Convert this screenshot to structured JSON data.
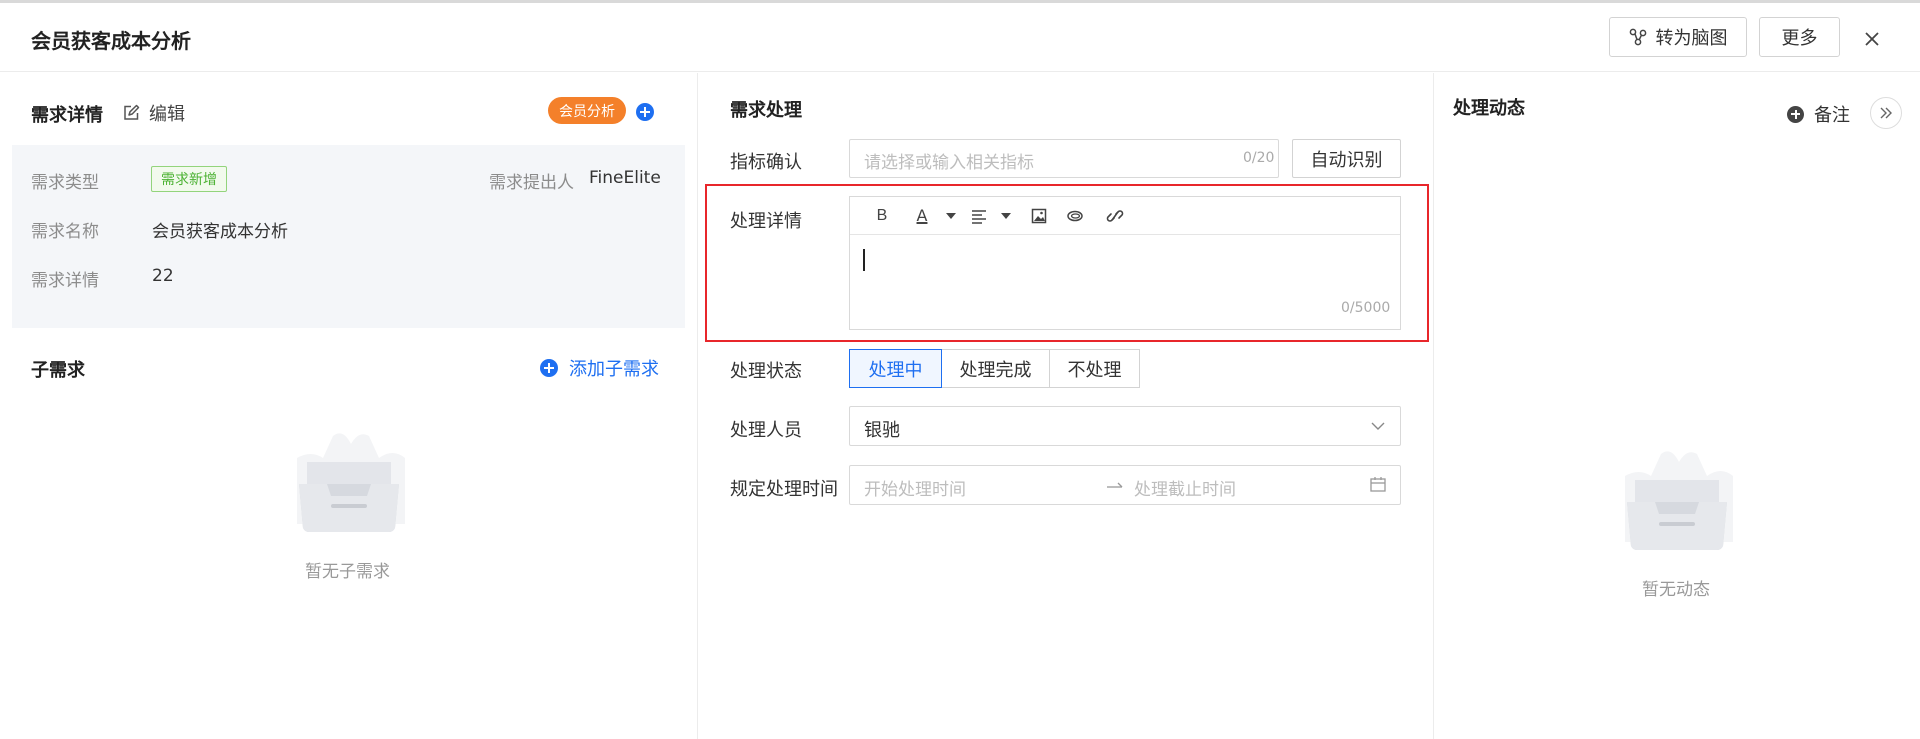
{
  "header": {
    "title": "会员获客成本分析",
    "mindmap_label": "转为脑图",
    "more_label": "更多"
  },
  "left": {
    "section_title": "需求详情",
    "edit_label": "编辑",
    "category_tag": "会员分析",
    "fields": {
      "type_label": "需求类型",
      "type_tag": "需求新增",
      "submitter_label": "需求提出人",
      "submitter_value": "FineElite",
      "name_label": "需求名称",
      "name_value": "会员获客成本分析",
      "detail_label": "需求详情",
      "detail_value": "22"
    },
    "sub": {
      "title": "子需求",
      "add_label": "添加子需求",
      "empty_text": "暂无子需求"
    }
  },
  "middle": {
    "section_title": "需求处理",
    "metric": {
      "label": "指标确认",
      "placeholder": "请选择或输入相关指标",
      "count": "0/20",
      "auto_label": "自动识别"
    },
    "detail": {
      "label": "处理详情",
      "toolbar": {
        "bold": "B",
        "font_color": "A"
      },
      "count": "0/5000"
    },
    "status": {
      "label": "处理状态",
      "options": [
        "处理中",
        "处理完成",
        "不处理"
      ],
      "active_index": 0
    },
    "handler": {
      "label": "处理人员",
      "value": "银驰"
    },
    "time": {
      "label": "规定处理时间",
      "start_placeholder": "开始处理时间",
      "end_placeholder": "处理截止时间"
    }
  },
  "right": {
    "section_title": "处理动态",
    "note_label": "备注",
    "empty_text": "暂无动态"
  },
  "colors": {
    "accent": "#1e6ff1",
    "orange_tag": "#f4802a",
    "green_tag": "#4cb233",
    "highlight": "#e8262b"
  }
}
